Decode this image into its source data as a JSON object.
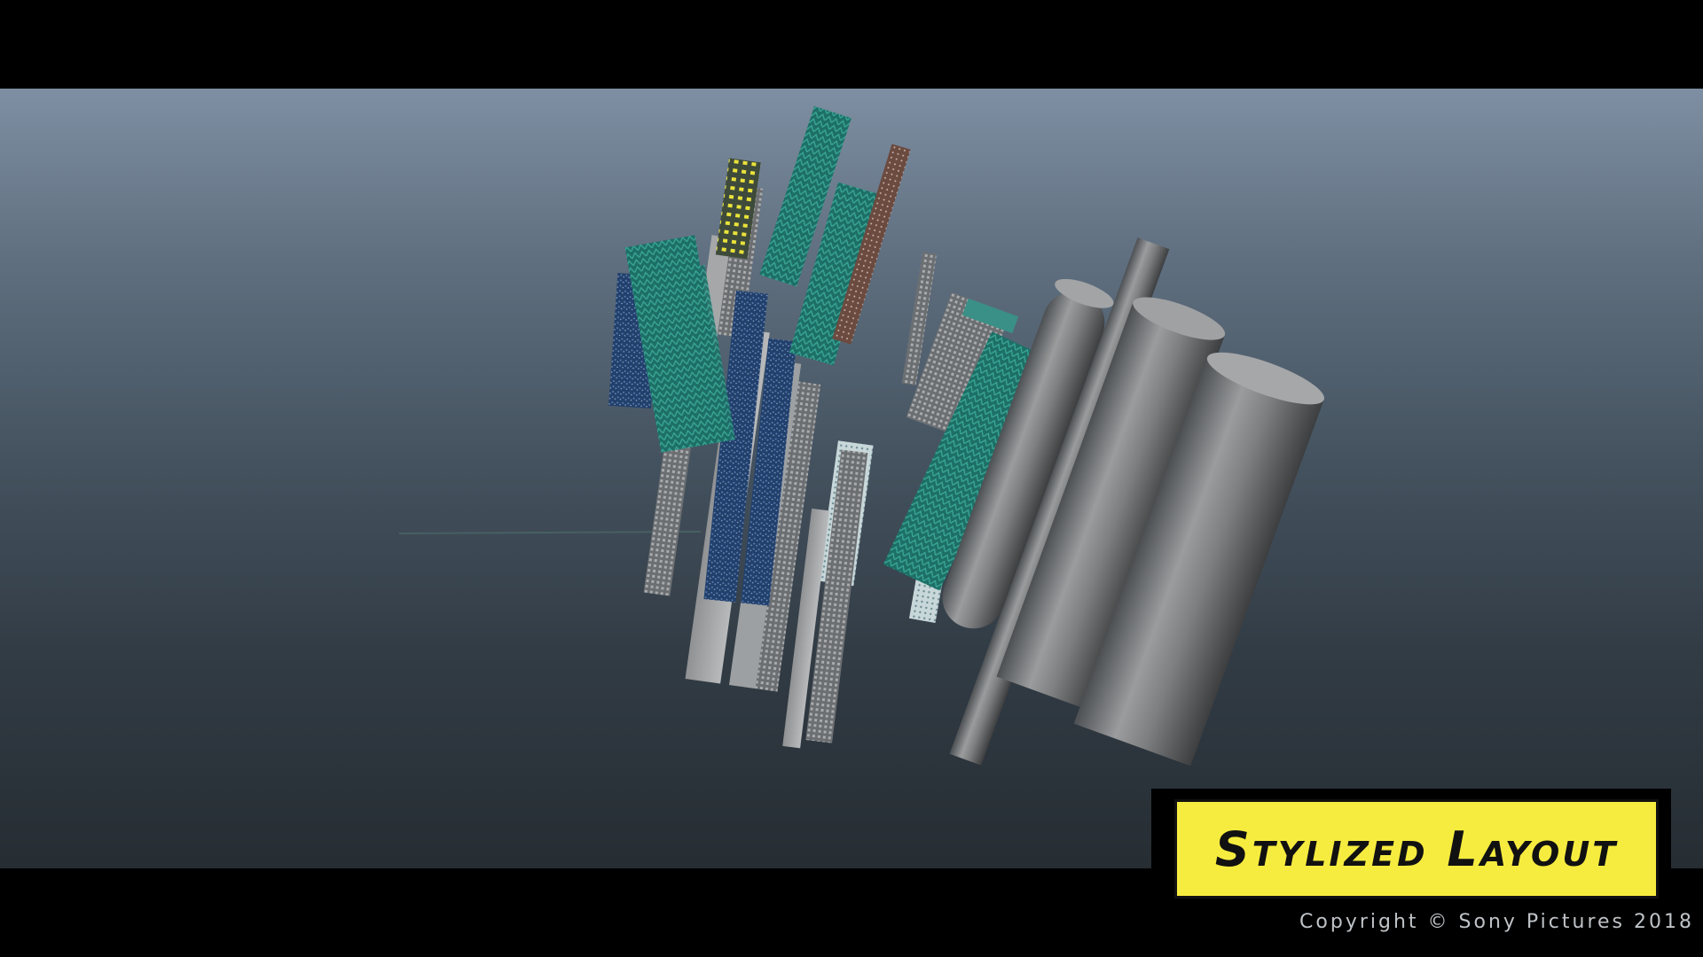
{
  "overlay": {
    "title": "Stylized Layout",
    "copyright": "Copyright © Sony Pictures 2018"
  },
  "colors": {
    "title_plate": "#f6ec3f",
    "teal_texture": "#1f7a6e",
    "blue_texture": "#24406e",
    "gray_cylinder": "#7d7f80",
    "brown_panel": "#6b4a3a"
  },
  "scene": {
    "description_icon": "3d-viewport-icon"
  }
}
